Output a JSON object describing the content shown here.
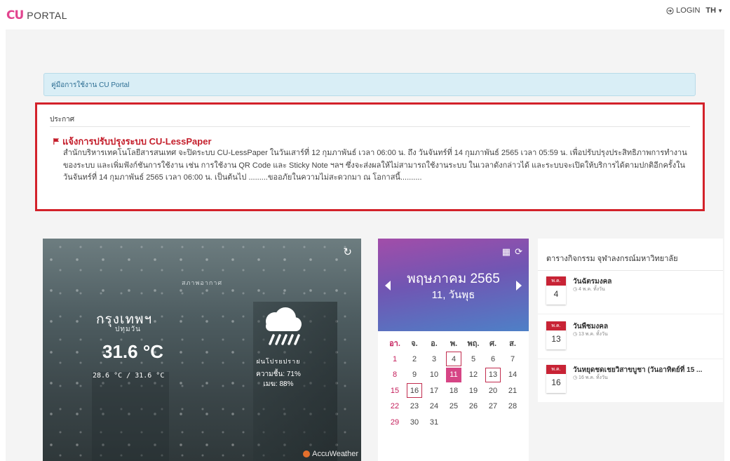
{
  "header": {
    "logo_mark": "CU",
    "logo_text": "PORTAL",
    "login_label": "LOGIN",
    "lang_label": "TH"
  },
  "manual_link": "คู่มือการใช้งาน CU Portal",
  "announcement": {
    "heading": "ประกาศ",
    "title": "แจ้งการปรับปรุงระบบ CU-LessPaper",
    "body": "สำนักบริหารเทคโนโลยีสารสนเทศ จะปิดระบบ CU-LessPaper ในวันเสาร์ที่ 12 กุมภาพันธ์ เวลา 06:00 น. ถึง วันจันทร์ที่ 14 กุมภาพันธ์ 2565 เวลา 05:59 น. เพื่อปรับปรุงประสิทธิภาพการทำงานของระบบ และเพิ่มฟังก์ชันการใช้งาน เช่น การใช้งาน QR Code และ Sticky Note ฯลฯ ซึ่งจะส่งผลให้ไม่สามารถใช้งานระบบ ในเวลาดังกล่าวได้ และระบบจะเปิดให้บริการได้ตามปกติอีกครั้งในวันจันทร์ที่ 14 กุมภาพันธ์ 2565 เวลา 06:00 น. เป็นต้นไป .........ขออภัยในความไม่สะดวกมา ณ โอกาสนี้.........."
  },
  "weather": {
    "label": "สภาพอากาศ",
    "city": "กรุงเทพฯ",
    "district": "ปทุมวัน",
    "temperature": "31.6 °C",
    "range": "28.6 °C / 31.6 °C",
    "condition": "ฝนโปรยปราย",
    "humidity": "ความชื้น: 71%",
    "cloud_cover": "เมฆ: 88%",
    "provider": "AccuWeather",
    "icon": "rain-cloud-icon"
  },
  "calendar": {
    "month_year": "พฤษภาคม 2565",
    "day_label": "11, วันพุธ",
    "weekdays": [
      "อา.",
      "จ.",
      "อ.",
      "พ.",
      "พฤ.",
      "ศ.",
      "ส."
    ],
    "days": [
      "1",
      "2",
      "3",
      "4",
      "5",
      "6",
      "7",
      "8",
      "9",
      "10",
      "11",
      "12",
      "13",
      "14",
      "15",
      "16",
      "17",
      "18",
      "19",
      "20",
      "21",
      "22",
      "23",
      "24",
      "25",
      "26",
      "27",
      "28",
      "29",
      "30",
      "31"
    ],
    "today": "11",
    "marked": [
      "4",
      "13",
      "16"
    ],
    "accent": "#d64585"
  },
  "events": {
    "title": "ตารางกิจกรรม จุฬาลงกรณ์มหาวิทยาลัย",
    "items": [
      {
        "month": "พ.ค.",
        "date": "4",
        "title": "วันฉัตรมงคล",
        "sub": "◷ 4 พ.ค. ทั้งวัน"
      },
      {
        "month": "พ.ค.",
        "date": "13",
        "title": "วันพืชมงคล",
        "sub": "◷ 13 พ.ค. ทั้งวัน"
      },
      {
        "month": "พ.ค.",
        "date": "16",
        "title": "วันหยุดชดเชยวิสาขบูชา (วันอาทิตย์ที่ 15 ...",
        "sub": "◷ 16 พ.ค. ทั้งวัน"
      }
    ]
  }
}
